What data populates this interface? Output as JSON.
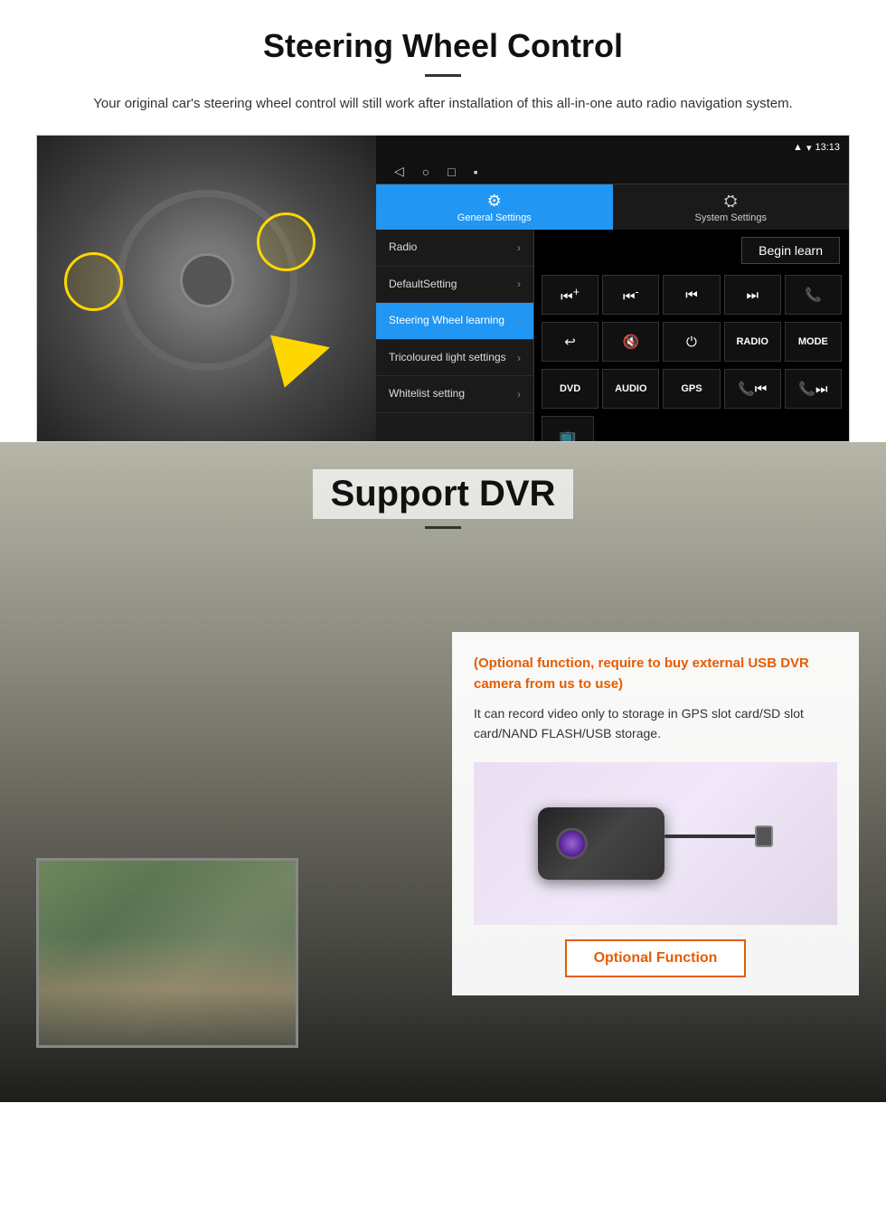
{
  "steering": {
    "title": "Steering Wheel Control",
    "subtitle": "Your original car's steering wheel control will still work after installation of this all-in-one auto radio navigation system.",
    "statusbar": {
      "time": "13:13",
      "icons": [
        "signal",
        "wifi",
        "battery"
      ]
    },
    "nav_icons": [
      "◁",
      "○",
      "□",
      "⬛"
    ],
    "tabs": [
      {
        "label": "General Settings",
        "icon": "⚙",
        "active": true
      },
      {
        "label": "System Settings",
        "icon": "🔄",
        "active": false
      }
    ],
    "menu_items": [
      {
        "label": "Radio",
        "active": false
      },
      {
        "label": "DefaultSetting",
        "active": false
      },
      {
        "label": "Steering Wheel learning",
        "active": true
      },
      {
        "label": "Tricoloured light settings",
        "active": false
      },
      {
        "label": "Whitelist setting",
        "active": false
      }
    ],
    "begin_learn": "Begin learn",
    "control_buttons_row1": [
      "⏮+",
      "⏮-",
      "⏮",
      "⏭",
      "📞"
    ],
    "control_buttons_row2": [
      "↩",
      "🔇x",
      "⏻",
      "RADIO",
      "MODE"
    ],
    "control_buttons_row3": [
      "DVD",
      "AUDIO",
      "GPS",
      "📞⏮",
      "📞⏭"
    ],
    "control_buttons_row4": [
      "📺"
    ]
  },
  "dvr": {
    "title": "Support DVR",
    "optional_text": "(Optional function, require to buy external USB DVR camera from us to use)",
    "desc_text": "It can record video only to storage in GPS slot card/SD slot card/NAND FLASH/USB storage.",
    "optional_function_btn": "Optional Function"
  }
}
